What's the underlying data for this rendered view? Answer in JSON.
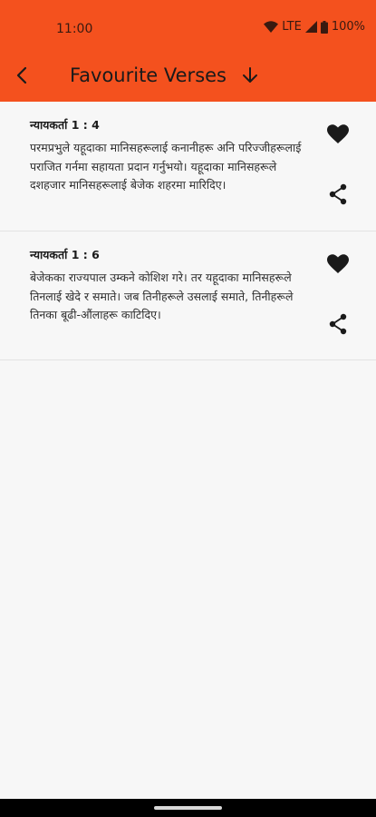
{
  "status_bar": {
    "time": "11:00",
    "network": "LTE",
    "battery": "100%",
    "icons": [
      "wifi-icon",
      "signal-icon",
      "battery-icon"
    ]
  },
  "app_bar": {
    "title": "Favourite Verses",
    "icons": [
      "back-arrow-icon",
      "download-arrow-icon"
    ],
    "background_color": "#f4511e"
  },
  "verses": [
    {
      "reference": "न्यायकर्ता 1 : 4",
      "text": "परमप्रभुले यहूदाका मानिसहरूलाई कनानीहरू अनि परिज्जीहरूलाई पराजित गर्नमा सहायता प्रदान गर्नुभयो। यहूदाका मानिसहरूले दशहजार मानिसहरूलाई बेजेक शहरमा मारिदिए।",
      "icons": [
        "heart-icon",
        "share-icon"
      ]
    },
    {
      "reference": "न्यायकर्ता 1 : 6",
      "text": "बेजेकका राज्यपाल उम्कने कोशिश गरे। तर यहूदाका मानिसहरूले तिनलाई खेदे र समाते। जब तिनीहरूले उसलाई समाते, तिनीहरूले तिनका बूढी-औंलाहरू काटिदिए।",
      "icons": [
        "heart-icon",
        "share-icon"
      ]
    }
  ]
}
